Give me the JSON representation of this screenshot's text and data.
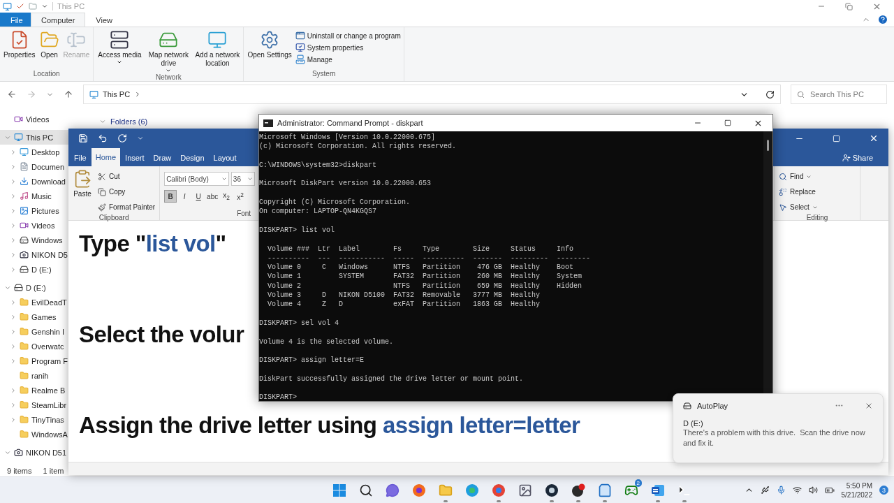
{
  "explorer": {
    "title": "This PC",
    "tabs": [
      {
        "label": "File",
        "kind": "file",
        "selected": false
      },
      {
        "label": "Computer",
        "kind": "tab",
        "selected": true
      },
      {
        "label": "View",
        "kind": "tab",
        "selected": false
      }
    ],
    "ribbon_groups": [
      {
        "label": "Location",
        "buttons": [
          {
            "label": "Properties",
            "kind": "properties",
            "disabled": false,
            "dropdown": false
          },
          {
            "label": "Open",
            "kind": "open",
            "disabled": false,
            "dropdown": false
          },
          {
            "label": "Rename",
            "kind": "rename",
            "disabled": true,
            "dropdown": false
          }
        ]
      },
      {
        "label": "Network",
        "buttons": [
          {
            "label": "Access media",
            "kind": "media",
            "disabled": false,
            "dropdown": true
          },
          {
            "label": "Map network drive",
            "kind": "map",
            "disabled": false,
            "dropdown": true
          },
          {
            "label": "Add a network location",
            "kind": "location",
            "disabled": false,
            "dropdown": false
          }
        ]
      },
      {
        "label": "System",
        "buttons": [
          {
            "label": "Open Settings",
            "kind": "settings",
            "disabled": false,
            "dropdown": false
          }
        ],
        "small_buttons": [
          {
            "label": "Uninstall or change a program",
            "kind": "uninstall"
          },
          {
            "label": "System properties",
            "kind": "sysprops"
          },
          {
            "label": "Manage",
            "kind": "manage"
          }
        ]
      }
    ],
    "address": "This PC",
    "search_placeholder": "Search This PC",
    "nav": [
      {
        "label": "Videos",
        "kind": "video",
        "selected": false
      },
      {
        "label": "This PC",
        "kind": "pc",
        "selected": true,
        "expanded": true,
        "children": [
          {
            "label": "Desktop",
            "kind": "desktop",
            "selected": false,
            "expanded": false
          },
          {
            "label": "Documen",
            "kind": "documents",
            "selected": false,
            "expanded": false
          },
          {
            "label": "Download",
            "kind": "downloads",
            "selected": false,
            "expanded": false
          },
          {
            "label": "Music",
            "kind": "music",
            "selected": false,
            "expanded": false
          },
          {
            "label": "Pictures",
            "kind": "pictures",
            "selected": false,
            "expanded": false
          },
          {
            "label": "Videos",
            "kind": "video",
            "selected": false,
            "expanded": false
          },
          {
            "label": "Windows",
            "kind": "system-drive",
            "selected": false,
            "expanded": false
          },
          {
            "label": "NIKON D5",
            "kind": "card",
            "selected": false,
            "expanded": false
          },
          {
            "label": "D (E:)",
            "kind": "drive",
            "selected": false,
            "expanded": false
          }
        ]
      },
      {
        "label": "D (E:)",
        "kind": "drive",
        "selected": false,
        "expanded": true,
        "children": [
          {
            "label": "EvilDeadT",
            "kind": "folder",
            "selected": false,
            "expanded": false
          },
          {
            "label": "Games",
            "kind": "folder",
            "selected": false,
            "expanded": false
          },
          {
            "label": "Genshin I",
            "kind": "folder",
            "selected": false,
            "expanded": false
          },
          {
            "label": "Overwatc",
            "kind": "folder",
            "selected": false,
            "expanded": false
          },
          {
            "label": "Program F",
            "kind": "folder",
            "selected": false,
            "expanded": false
          },
          {
            "label": "ranih",
            "kind": "folder",
            "selected": false
          },
          {
            "label": "Realme B",
            "kind": "folder",
            "selected": false,
            "expanded": false
          },
          {
            "label": "SteamLibr",
            "kind": "folder",
            "selected": false,
            "expanded": false
          },
          {
            "label": "TinyTinas",
            "kind": "folder",
            "selected": false,
            "expanded": false
          },
          {
            "label": "WindowsA",
            "kind": "folder",
            "selected": false
          }
        ]
      },
      {
        "label": "NIKON D51",
        "kind": "card",
        "selected": false,
        "expanded": true
      }
    ],
    "section_header": "Folders (6)",
    "status": [
      "9 items",
      "1 item"
    ]
  },
  "word": {
    "tabs": [
      {
        "label": "File",
        "selected": false
      },
      {
        "label": "Home",
        "selected": true
      },
      {
        "label": "Insert",
        "selected": false
      },
      {
        "label": "Draw",
        "selected": false
      },
      {
        "label": "Design",
        "selected": false
      },
      {
        "label": "Layout",
        "selected": false
      }
    ],
    "share": "Share",
    "clipboard": {
      "paste": "Paste",
      "label": "Clipboard",
      "items": [
        {
          "label": "Cut",
          "kind": "cut"
        },
        {
          "label": "Copy",
          "kind": "copy"
        },
        {
          "label": "Format Painter",
          "kind": "painter"
        }
      ]
    },
    "font": {
      "family": "Calibri (Body)",
      "size": "36",
      "label": "Font",
      "buttons": [
        {
          "label": "B",
          "kind": "bold",
          "pressed": true
        },
        {
          "label": "I",
          "kind": "italic",
          "pressed": false
        },
        {
          "label": "U",
          "kind": "underline",
          "pressed": false
        },
        {
          "label": "abc",
          "kind": "strike",
          "pressed": false
        },
        {
          "label": "x$_{2}$",
          "kind": "sub",
          "pressed": false
        },
        {
          "label": "x$^{2}$",
          "kind": "sup",
          "pressed": false
        }
      ]
    },
    "editing": {
      "label": "Editing",
      "items": [
        {
          "label": "Find",
          "kind": "find",
          "dropdown": true
        },
        {
          "label": "Replace",
          "kind": "replace",
          "dropdown": false
        },
        {
          "label": "Select",
          "kind": "select",
          "dropdown": true
        }
      ]
    },
    "document": [
      {
        "parts": [
          {
            "text": "Type \"",
            "accent": false
          },
          {
            "text": "list vol",
            "accent": true
          },
          {
            "text": "\"",
            "accent": false
          }
        ]
      },
      {
        "parts": [
          {
            "text": "Select the volur",
            "accent": false
          }
        ]
      },
      {
        "parts": [
          {
            "text": "Assign the drive letter using ",
            "accent": false
          },
          {
            "text": "assign letter=letter",
            "accent": true
          }
        ]
      }
    ]
  },
  "console": {
    "title": "Administrator: Command Prompt - diskpart",
    "blocks": [
      [
        "Microsoft Windows [Version 10.0.22000.675]",
        "(c) Microsoft Corporation. All rights reserved."
      ],
      [
        "C:\\WINDOWS\\system32>diskpart"
      ],
      [
        "Microsoft DiskPart version 10.0.22000.653"
      ],
      [
        "Copyright (C) Microsoft Corporation.",
        "On computer: LAPTOP-QN4KGQS7"
      ],
      [
        "DISKPART> list vol"
      ],
      [
        "  Volume ###  Ltr  Label        Fs     Type        Size     Status     Info",
        "  ----------  ---  -----------  -----  ----------  -------  ---------  --------",
        "  Volume 0     C   Windows      NTFS   Partition    476 GB  Healthy    Boot",
        "  Volume 1         SYSTEM       FAT32  Partition    260 MB  Healthy    System",
        "  Volume 2                      NTFS   Partition    659 MB  Healthy    Hidden",
        "  Volume 3     D   NIKON D5100  FAT32  Removable   3777 MB  Healthy",
        "  Volume 4     Z   D            exFAT  Partition   1863 GB  Healthy"
      ],
      [
        "DISKPART> sel vol 4"
      ],
      [
        "Volume 4 is the selected volume."
      ],
      [
        "DISKPART> assign letter=E"
      ],
      [
        "DiskPart successfully assigned the drive letter or mount point."
      ],
      [
        "DISKPART>"
      ]
    ]
  },
  "toast": {
    "app": "AutoPlay",
    "heading": "D (E:)",
    "message": "There's a problem with this drive.  Scan the drive now and fix it."
  },
  "taskbar": {
    "apps": [
      {
        "kind": "start",
        "open": false
      },
      {
        "kind": "search",
        "open": false
      },
      {
        "kind": "chat",
        "open": false
      },
      {
        "kind": "firefox",
        "open": false
      },
      {
        "kind": "files",
        "open": true
      },
      {
        "kind": "edge",
        "open": false
      },
      {
        "kind": "chrome",
        "open": true
      },
      {
        "kind": "photos",
        "open": false
      },
      {
        "kind": "steam",
        "open": true
      },
      {
        "kind": "app",
        "open": true
      },
      {
        "kind": "store",
        "open": true
      },
      {
        "kind": "xbox",
        "open": false,
        "badge": "2"
      },
      {
        "kind": "word",
        "open": true
      },
      {
        "kind": "terminal",
        "open": true
      }
    ],
    "time": "5:50 PM",
    "date": "5/21/2022",
    "notifications": "3"
  }
}
